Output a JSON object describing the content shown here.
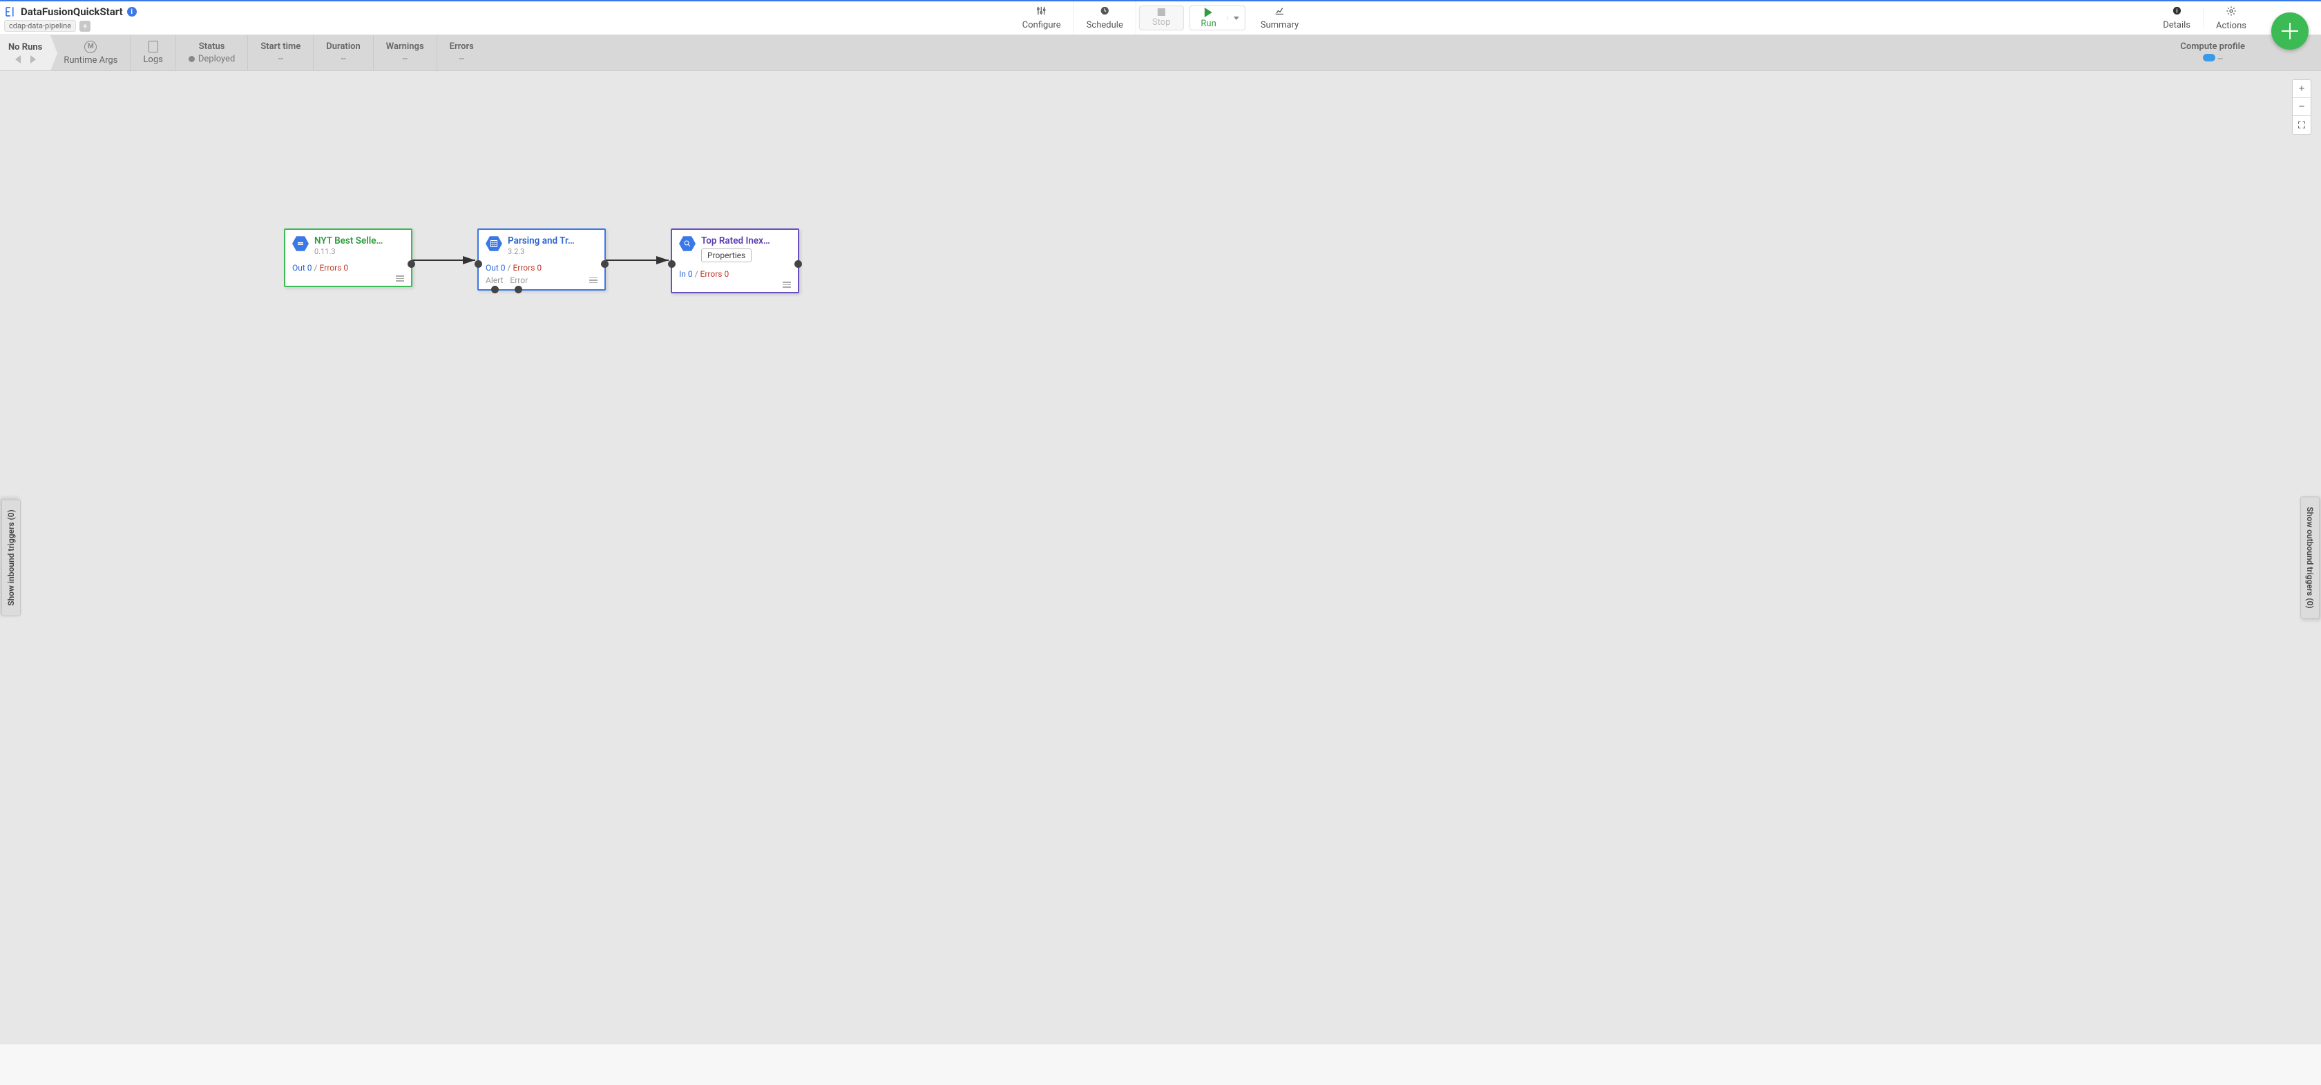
{
  "header": {
    "app_title": "DataFusionQuickStart",
    "pipeline_chip": "cdap-data-pipeline",
    "configure": "Configure",
    "schedule": "Schedule",
    "stop": "Stop",
    "run": "Run",
    "summary": "Summary",
    "details": "Details",
    "actions": "Actions"
  },
  "status_bar": {
    "no_runs": "No Runs",
    "runtime_args": "Runtime Args",
    "logs": "Logs",
    "status_label": "Status",
    "status_value": "Deployed",
    "start_time_label": "Start time",
    "start_time_value": "--",
    "duration_label": "Duration",
    "duration_value": "--",
    "warnings_label": "Warnings",
    "warnings_value": "--",
    "errors_label": "Errors",
    "errors_value": "--",
    "compute_profile_label": "Compute profile",
    "compute_profile_value": "--"
  },
  "triggers": {
    "inbound": "Show inbound triggers (0)",
    "outbound": "Show outbound triggers (0)"
  },
  "nodes": [
    {
      "title": "NYT Best Selle…",
      "version": "0.11.3",
      "metric_left_label": "Out",
      "metric_left_val": "0",
      "metric_err_label": "Errors",
      "metric_err_val": "0",
      "show_alert_error": false,
      "show_properties": false
    },
    {
      "title": "Parsing and Tr…",
      "version": "3.2.3",
      "metric_left_label": "Out",
      "metric_left_val": "0",
      "metric_err_label": "Errors",
      "metric_err_val": "0",
      "alert_label": "Alert",
      "error_label": "Error",
      "show_alert_error": true,
      "show_properties": false
    },
    {
      "title": "Top Rated Inex…",
      "properties_label": "Properties",
      "metric_left_label": "In",
      "metric_left_val": "0",
      "metric_err_label": "Errors",
      "metric_err_val": "0",
      "show_alert_error": false,
      "show_properties": true
    }
  ]
}
